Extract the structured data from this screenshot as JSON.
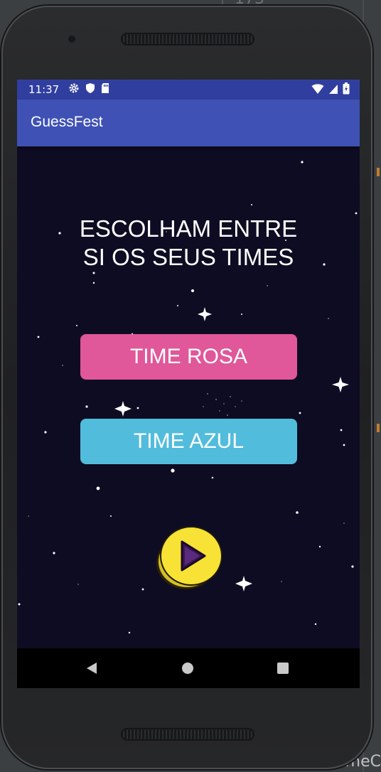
{
  "ide": {
    "top_fragment": "173",
    "bottom_fragment": "meC"
  },
  "status_bar": {
    "time": "11:37",
    "left_icons": [
      "gear-icon",
      "shield-icon",
      "sd-card-icon"
    ],
    "right_icons": [
      "wifi-icon",
      "signal-icon",
      "battery-icon"
    ]
  },
  "app_bar": {
    "title": "GuessFest"
  },
  "main": {
    "prompt_line1": "ESCOLHAM ENTRE",
    "prompt_line2": "SI OS SEUS TIMES",
    "team_pink_label": "TIME ROSA",
    "team_blue_label": "TIME AZUL",
    "play_icon": "play-icon"
  },
  "nav_bar": {
    "icons": [
      "back-icon",
      "home-icon",
      "recents-icon"
    ]
  },
  "colors": {
    "status_bar": "#303f9f",
    "app_bar": "#3f51b5",
    "background": "#0e0c22",
    "team_pink": "#e0579a",
    "team_blue": "#52bcdc",
    "play_button": "#f7e235"
  }
}
